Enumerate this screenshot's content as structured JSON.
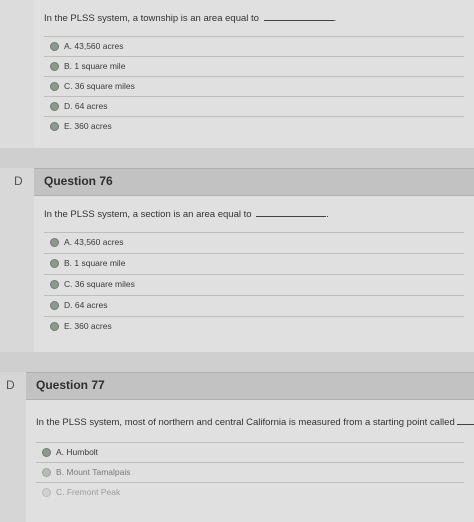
{
  "q75": {
    "text": "In the PLSS system, a township is an area equal to",
    "options": [
      "A. 43,560 acres",
      "B. 1 square mile",
      "C. 36 square miles",
      "D. 64 acres",
      "E. 360 acres"
    ]
  },
  "q76": {
    "title": "Question 76",
    "flag": "D",
    "text": "In the PLSS system, a section is an area equal to",
    "options": [
      "A. 43,560 acres",
      "B. 1 square mile",
      "C. 36 square miles",
      "D. 64 acres",
      "E. 360 acres"
    ]
  },
  "q77": {
    "title": "Question 77",
    "flag": "D",
    "text": "In the PLSS system, most of northern and central California is measured from a starting point called",
    "options": [
      "A. Humbolt",
      "B. Mount Tamalpais",
      "C. Fremont Peak"
    ]
  }
}
